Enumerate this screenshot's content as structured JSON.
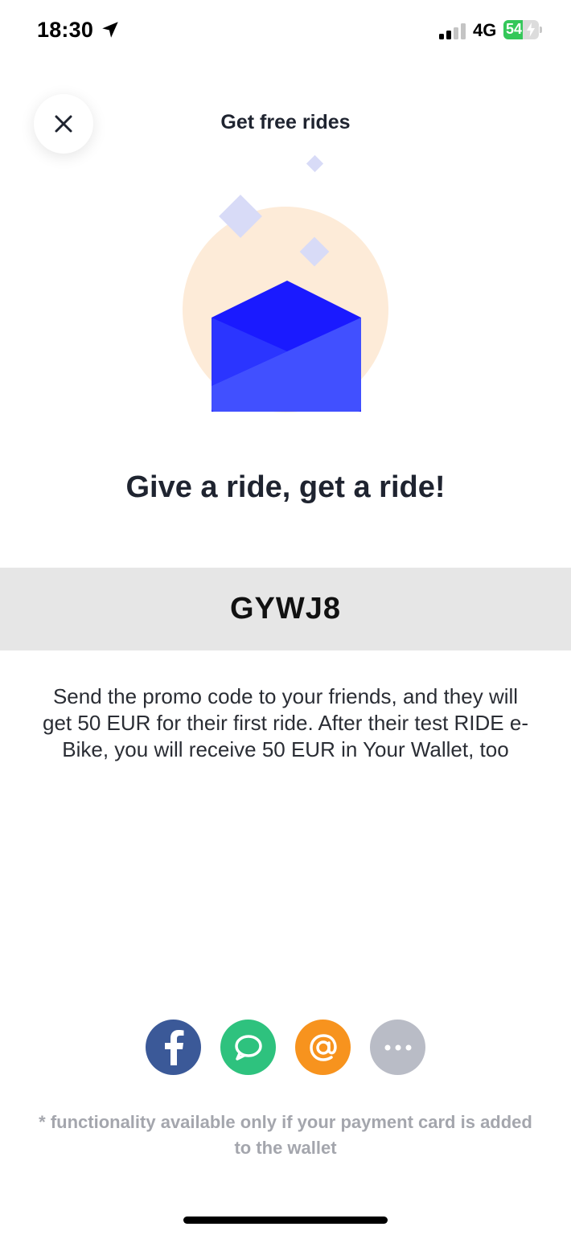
{
  "status_bar": {
    "time": "18:30",
    "network": "4G",
    "battery": "54",
    "battery_level": 0.54,
    "location_icon": "location-arrow-icon",
    "signal_icon": "cellular-signal-icon"
  },
  "header": {
    "title": "Get free rides",
    "close_icon": "close-icon"
  },
  "illustration": {
    "icon": "open-envelope-icon",
    "colors": {
      "circle": "#fdebd8",
      "envelope_dark": "#1a1aff",
      "envelope_light": "#4150ff",
      "diamond": "#d8dbf7"
    }
  },
  "headline": "Give a ride, get a ride!",
  "promo": {
    "code": "GYWJ8",
    "description": "Send the promo code to your friends, and they will get 50 EUR for their first ride. After their test RIDE e-Bike, you will receive 50 EUR in Your Wallet, too"
  },
  "share": {
    "buttons": [
      {
        "name": "facebook",
        "icon": "facebook-icon",
        "color": "#3b5998"
      },
      {
        "name": "messages",
        "icon": "message-bubble-icon",
        "color": "#2ec27e"
      },
      {
        "name": "email",
        "icon": "at-sign-icon",
        "color": "#f7931e"
      },
      {
        "name": "more",
        "icon": "more-dots-icon",
        "color": "#b9bcc6"
      }
    ]
  },
  "footnote": "* functionality available only if your payment card is added to the wallet"
}
